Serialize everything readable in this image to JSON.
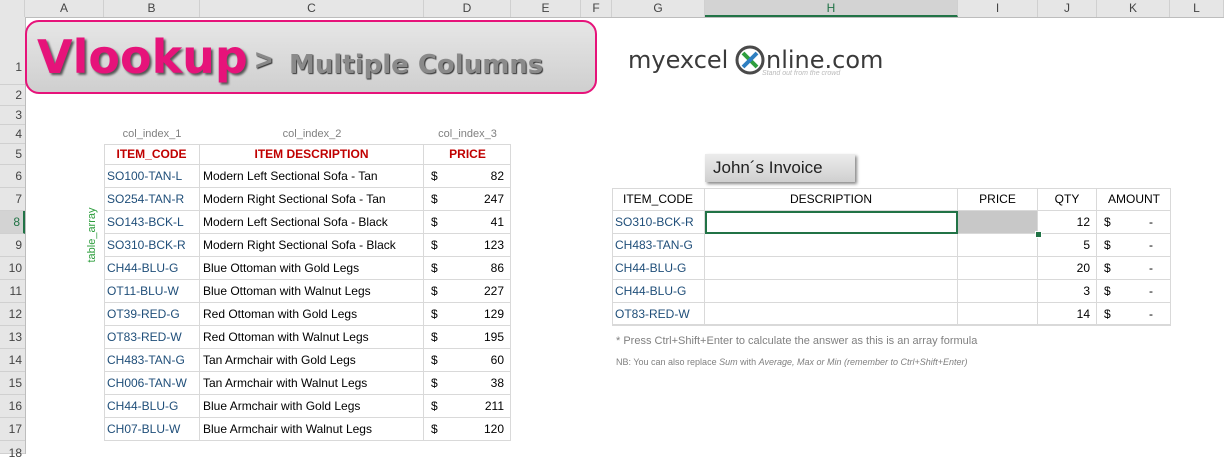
{
  "columns": [
    "",
    "A",
    "B",
    "C",
    "D",
    "E",
    "F",
    "G",
    "H",
    "I",
    "J",
    "K",
    "L"
  ],
  "rows": [
    "1",
    "2",
    "3",
    "4",
    "5",
    "6",
    "7",
    "8",
    "9",
    "10",
    "11",
    "12",
    "13",
    "14",
    "15",
    "16",
    "17",
    "18"
  ],
  "banner": {
    "title": "Vlookup",
    "arrow": ">",
    "subtitle": "Multiple Columns"
  },
  "logo": {
    "part1": "myexcel",
    "part2": "nline.com",
    "tagline": "Stand out from the crowd"
  },
  "col_index_labels": [
    "col_index_1",
    "col_index_2",
    "col_index_3"
  ],
  "table_array_label": "table_array",
  "left_table": {
    "headers": [
      "ITEM_CODE",
      "ITEM DESCRIPTION",
      "PRICE"
    ],
    "currency": "$",
    "rows": [
      {
        "code": "SO100-TAN-L",
        "desc": "Modern Left Sectional Sofa - Tan",
        "price": "82"
      },
      {
        "code": "SO254-TAN-R",
        "desc": "Modern Right Sectional Sofa - Tan",
        "price": "247"
      },
      {
        "code": "SO143-BCK-L",
        "desc": "Modern Left Sectional Sofa - Black",
        "price": "41"
      },
      {
        "code": "SO310-BCK-R",
        "desc": "Modern Right Sectional Sofa - Black",
        "price": "123"
      },
      {
        "code": "CH44-BLU-G",
        "desc": "Blue Ottoman with Gold Legs",
        "price": "86"
      },
      {
        "code": "OT11-BLU-W",
        "desc": "Blue Ottoman with Walnut Legs",
        "price": "227"
      },
      {
        "code": "OT39-RED-G",
        "desc": "Red Ottoman with Gold Legs",
        "price": "129"
      },
      {
        "code": "OT83-RED-W",
        "desc": "Red Ottoman with Walnut Legs",
        "price": "195"
      },
      {
        "code": "CH483-TAN-G",
        "desc": "Tan Armchair with Gold Legs",
        "price": "60"
      },
      {
        "code": "CH006-TAN-W",
        "desc": "Tan Armchair with Walnut Legs",
        "price": "38"
      },
      {
        "code": "CH44-BLU-G",
        "desc": "Blue Armchair with Gold Legs",
        "price": "211"
      },
      {
        "code": "CH07-BLU-W",
        "desc": "Blue Armchair with Walnut Legs",
        "price": "120"
      }
    ]
  },
  "invoice": {
    "title": "John´s Invoice",
    "headers": [
      "ITEM_CODE",
      "DESCRIPTION",
      "PRICE",
      "QTY",
      "AMOUNT"
    ],
    "currency": "$",
    "rows": [
      {
        "code": "SO310-BCK-R",
        "desc": "",
        "price": "",
        "qty": "12",
        "amount": "-"
      },
      {
        "code": "CH483-TAN-G",
        "desc": "",
        "price": "",
        "qty": "5",
        "amount": "-"
      },
      {
        "code": "CH44-BLU-G",
        "desc": "",
        "price": "",
        "qty": "20",
        "amount": "-"
      },
      {
        "code": "CH44-BLU-G",
        "desc": "",
        "price": "",
        "qty": "3",
        "amount": "-"
      },
      {
        "code": "OT83-RED-W",
        "desc": "",
        "price": "",
        "qty": "14",
        "amount": "-"
      }
    ]
  },
  "notes": {
    "note1": "* Press Ctrl+Shift+Enter to calculate the answer as this is an array formula",
    "note2_a": "NB: You can also replace ",
    "note2_b": "Sum",
    "note2_c": "  with ",
    "note2_d": "Average, Max or Min (remember to Ctrl+Shift+Enter)"
  },
  "colors": {
    "accent_red": "#c00000",
    "excel_green": "#217346",
    "banner_pink": "#e6137a",
    "code_blue": "#1f4e79"
  }
}
